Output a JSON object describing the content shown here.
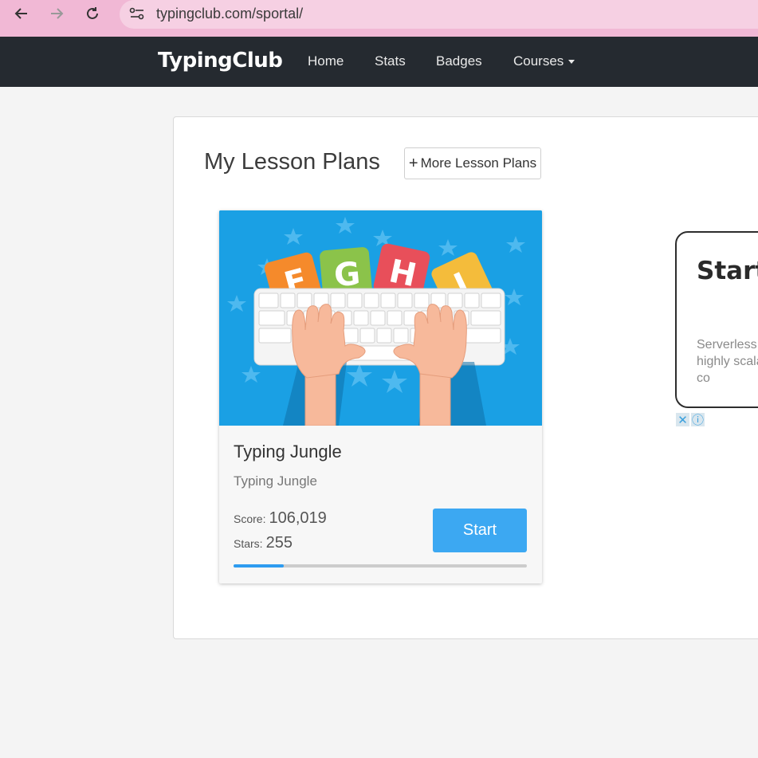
{
  "browser": {
    "url": "typingclub.com/sportal/",
    "icons": [
      "back-arrow-icon",
      "forward-arrow-icon",
      "reload-icon",
      "site-settings-icon"
    ]
  },
  "nav": {
    "brand": "TypingClub",
    "links": [
      "Home",
      "Stats",
      "Badges",
      "Courses"
    ]
  },
  "main": {
    "title": "My Lesson Plans",
    "more_button": "More Lesson Plans",
    "more_button_icon": "+"
  },
  "card": {
    "title": "Typing Jungle",
    "subtitle": "Typing Jungle",
    "score_label": "Score:",
    "score_value": "106,019",
    "stars_label": "Stars:",
    "stars_value": "255",
    "start_label": "Start",
    "progress_fraction": 0.17,
    "image_letters": [
      "F",
      "G",
      "H",
      "J"
    ]
  },
  "ad": {
    "headline": "Start trial r",
    "body": "Serverless, highly scalable, co",
    "close_icon": "✕",
    "info_icon": "ⓘ"
  },
  "colors": {
    "browser_bar": "#f1b8d5",
    "nav_bg": "#252a30",
    "accent": "#3ca8f2",
    "card_image_bg": "#1aa0e4"
  }
}
